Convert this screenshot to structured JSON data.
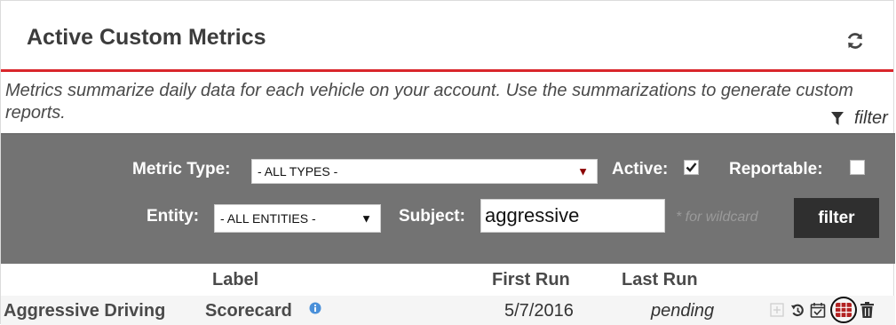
{
  "header": {
    "title": "Active Custom Metrics",
    "refresh_icon": "refresh-icon"
  },
  "description": "Metrics summarize daily data for each vehicle on your account. Use the summarizations to generate custom reports.",
  "filter_link": {
    "label": "filter",
    "icon": "funnel-icon"
  },
  "filters": {
    "metric_type_label": "Metric Type:",
    "metric_type_value": "- ALL TYPES -",
    "active_label": "Active:",
    "active_checked": true,
    "reportable_label": "Reportable:",
    "reportable_checked": false,
    "entity_label": "Entity:",
    "entity_value": "- ALL ENTITIES -",
    "subject_label": "Subject:",
    "subject_value": "aggressive",
    "wildcard_hint": "* for wildcard",
    "filter_button": "filter"
  },
  "table": {
    "columns": {
      "label": "Label",
      "first_run": "First Run",
      "last_run": "Last Run"
    },
    "rows": [
      {
        "label": "Aggressive Driving",
        "label_suffix": "Scorecard",
        "first_run": "5/7/2016",
        "last_run": "pending",
        "actions": [
          "expand-icon",
          "history-icon",
          "calendar-check-icon",
          "grid-icon",
          "trash-icon"
        ]
      }
    ]
  },
  "colors": {
    "accent": "#d9262b",
    "filter_bg": "#737373",
    "button_bg": "#2f2f2f",
    "info": "#4a90d9"
  }
}
